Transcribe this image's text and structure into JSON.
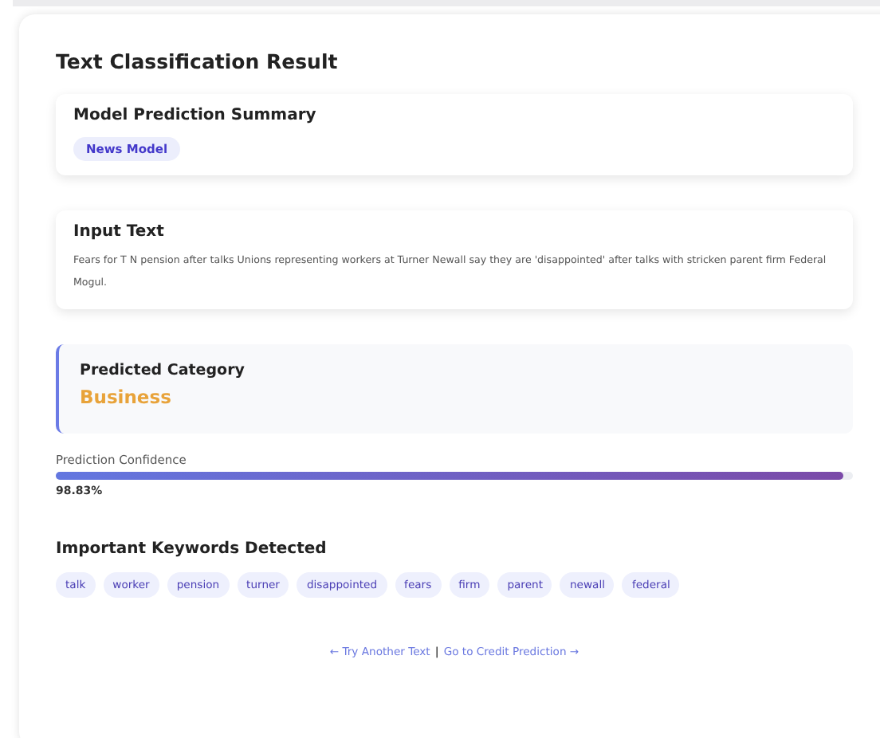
{
  "title": "Text Classification Result",
  "summary": {
    "heading": "Model Prediction Summary",
    "badge": "News Model"
  },
  "input": {
    "heading": "Input Text",
    "text": "Fears for T N pension after talks Unions representing workers at Turner Newall say they are 'disappointed' after talks with stricken parent firm Federal Mogul."
  },
  "category": {
    "heading": "Predicted Category",
    "value": "Business"
  },
  "confidence": {
    "label": "Prediction Confidence",
    "level": 0.9883,
    "reading": "98.83%"
  },
  "keywords": {
    "heading": "Important Keywords Detected",
    "items": [
      "talk",
      "worker",
      "pension",
      "turner",
      "disappointed",
      "fears",
      "firm",
      "parent",
      "newall",
      "federal"
    ]
  },
  "links": [
    {
      "label": "← Try Another Text"
    },
    {
      "label": "Go to Credit Prediction →"
    }
  ],
  "separator": "|"
}
